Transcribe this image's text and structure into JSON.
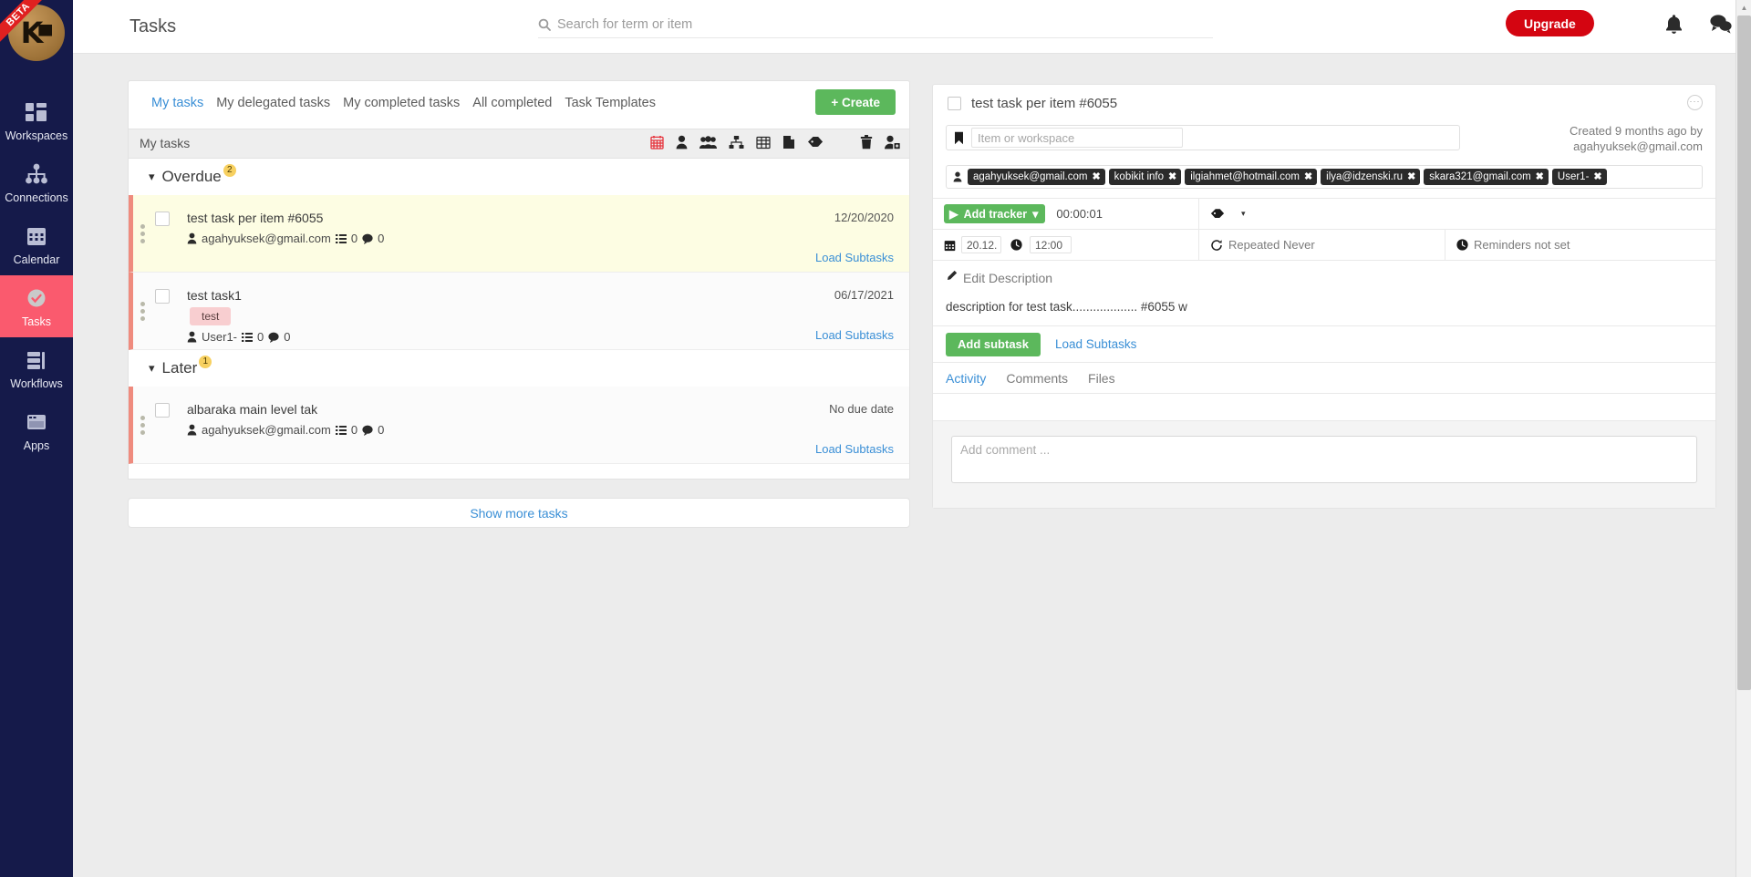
{
  "sidebar": {
    "logo": {
      "mark": "K",
      "ribbon": "BETA"
    },
    "items": [
      {
        "label": "Workspaces",
        "icon": "workspaces-icon",
        "active": false
      },
      {
        "label": "Connections",
        "icon": "connections-icon",
        "active": false
      },
      {
        "label": "Calendar",
        "icon": "calendar-icon",
        "active": false
      },
      {
        "label": "Tasks",
        "icon": "tasks-icon",
        "active": true
      },
      {
        "label": "Workflows",
        "icon": "workflows-icon",
        "active": false
      },
      {
        "label": "Apps",
        "icon": "apps-icon",
        "active": false
      }
    ]
  },
  "topbar": {
    "title": "Tasks",
    "search_placeholder": "Search for term or item",
    "search_value": "",
    "upgrade_label": "Upgrade",
    "icons": [
      "search-icon",
      "bell-icon",
      "chat-icon",
      "avatar"
    ],
    "accent_red": "#d40511"
  },
  "left": {
    "tabs": [
      {
        "label": "My tasks",
        "active": true
      },
      {
        "label": "My delegated tasks",
        "active": false
      },
      {
        "label": "My completed tasks",
        "active": false
      },
      {
        "label": "All completed",
        "active": false
      },
      {
        "label": "Task Templates",
        "active": false
      }
    ],
    "create_label": "+ Create",
    "toolbar_title": "My tasks",
    "toolbar_icons": [
      "calendar-icon",
      "user-icon",
      "group-icon",
      "hierarchy-icon",
      "table-icon",
      "document-icon",
      "tag-icon",
      "trash-icon",
      "add-user-icon"
    ],
    "groups": [
      {
        "name": "Overdue",
        "count": "2",
        "tasks": [
          {
            "title": "test task per item #6055",
            "due": "12/20/2020",
            "assignee": "agahyuksek@gmail.com",
            "subtask_count": "0",
            "comment_count": "0",
            "label": null,
            "load_subtasks": "Load Subtasks",
            "highlight": true
          },
          {
            "title": "test task1",
            "due": "06/17/2021",
            "assignee": "User1-",
            "subtask_count": "0",
            "comment_count": "0",
            "label": "test",
            "load_subtasks": "Load Subtasks",
            "highlight": false
          }
        ]
      },
      {
        "name": "Later",
        "count": "1",
        "tasks": [
          {
            "title": "albaraka main level tak",
            "due": "No due date",
            "assignee": "agahyuksek@gmail.com",
            "subtask_count": "0",
            "comment_count": "0",
            "label": null,
            "load_subtasks": "Load Subtasks",
            "highlight": false
          }
        ]
      }
    ],
    "show_more": "Show more tasks"
  },
  "detail": {
    "title": "test task per item #6055",
    "menu_icon": "ellipsis-icon",
    "workspace_placeholder": "Item or workspace",
    "workspace_value": "",
    "created_line1": "Created 9 months ago by",
    "created_line2": "agahyuksek@gmail.com",
    "assignees": [
      "agahyuksek@gmail.com",
      "kobikit info",
      "ilgiahmet@hotmail.com",
      "ilya@idzenski.ru",
      "skara321@gmail.com",
      "User1-"
    ],
    "chip_remove": "✖",
    "tracker_label": "Add tracker",
    "tracker_time": "00:00:01",
    "tag_icon": "tag-icon",
    "date_value": "20.12.",
    "time_value": "12:00",
    "repeat_text": "Repeated Never",
    "reminder_text": "Reminders not set",
    "edit_description": "Edit Description",
    "description": "description for test task................... #6055 w",
    "add_subtask": "Add subtask",
    "load_subtasks": "Load Subtasks",
    "tabs": [
      {
        "label": "Activity",
        "active": true
      },
      {
        "label": "Comments",
        "active": false
      },
      {
        "label": "Files",
        "active": false
      }
    ],
    "comment_placeholder": "Add comment ..."
  }
}
